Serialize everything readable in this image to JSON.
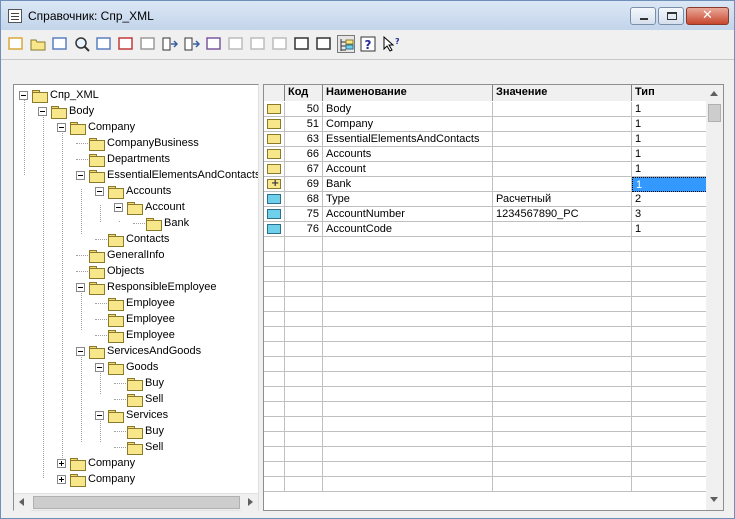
{
  "window": {
    "title": "Справочник: Спр_XML",
    "close_glyph": "✕"
  },
  "toolbar": {
    "icons": [
      "new-item-icon",
      "new-folder-icon",
      "copy-item-icon",
      "find-icon",
      "edit-item-icon",
      "delete-item-icon",
      "mark-delete-icon",
      "move-to-folder-icon",
      "level-down-icon",
      "hierarchy-view-icon",
      "filter-icon",
      "filter-off-icon",
      "copy-icon",
      "list-icon",
      "properties-icon",
      "tree-toggle-icon",
      "help-icon",
      "context-help-icon"
    ]
  },
  "tree": {
    "nodes": [
      {
        "label": "Спр_XML"
      },
      {
        "label": "Body"
      },
      {
        "label": "Company"
      },
      {
        "label": "CompanyBusiness"
      },
      {
        "label": "Departments"
      },
      {
        "label": "EssentialElementsAndContacts"
      },
      {
        "label": "Accounts"
      },
      {
        "label": "Account"
      },
      {
        "label": "Bank"
      },
      {
        "label": "Contacts"
      },
      {
        "label": "GeneralInfo"
      },
      {
        "label": "Objects"
      },
      {
        "label": "ResponsibleEmployee"
      },
      {
        "label": "Employee"
      },
      {
        "label": "Employee"
      },
      {
        "label": "Employee"
      },
      {
        "label": "ServicesAndGoods"
      },
      {
        "label": "Goods"
      },
      {
        "label": "Buy"
      },
      {
        "label": "Sell"
      },
      {
        "label": "Services"
      },
      {
        "label": "Buy"
      },
      {
        "label": "Sell"
      },
      {
        "label": "Company"
      },
      {
        "label": "Company"
      }
    ]
  },
  "grid": {
    "columns": [
      "",
      "Код",
      "Наименование",
      "Значение",
      "Тип"
    ],
    "rows": [
      {
        "icon": "folder-yellow",
        "code": "50",
        "name": "Body",
        "value": "",
        "type": "1"
      },
      {
        "icon": "folder-yellow",
        "code": "51",
        "name": "Company",
        "value": "",
        "type": "1"
      },
      {
        "icon": "folder-yellow",
        "code": "63",
        "name": "EssentialElementsAndContacts",
        "value": "",
        "type": "1"
      },
      {
        "icon": "folder-yellow",
        "code": "66",
        "name": "Accounts",
        "value": "",
        "type": "1"
      },
      {
        "icon": "folder-yellow",
        "code": "67",
        "name": "Account",
        "value": "",
        "type": "1"
      },
      {
        "icon": "folder-plus",
        "code": "69",
        "name": "Bank",
        "value": "",
        "type": "1"
      },
      {
        "icon": "element-blue",
        "code": "68",
        "name": "Type",
        "value": "Расчетный",
        "type": "2"
      },
      {
        "icon": "element-blue",
        "code": "75",
        "name": "AccountNumber",
        "value": "1234567890_PC",
        "type": "3"
      },
      {
        "icon": "element-blue",
        "code": "76",
        "name": "AccountCode",
        "value": "",
        "type": "1"
      }
    ],
    "selected_row": 5,
    "empty_rows": 17
  }
}
